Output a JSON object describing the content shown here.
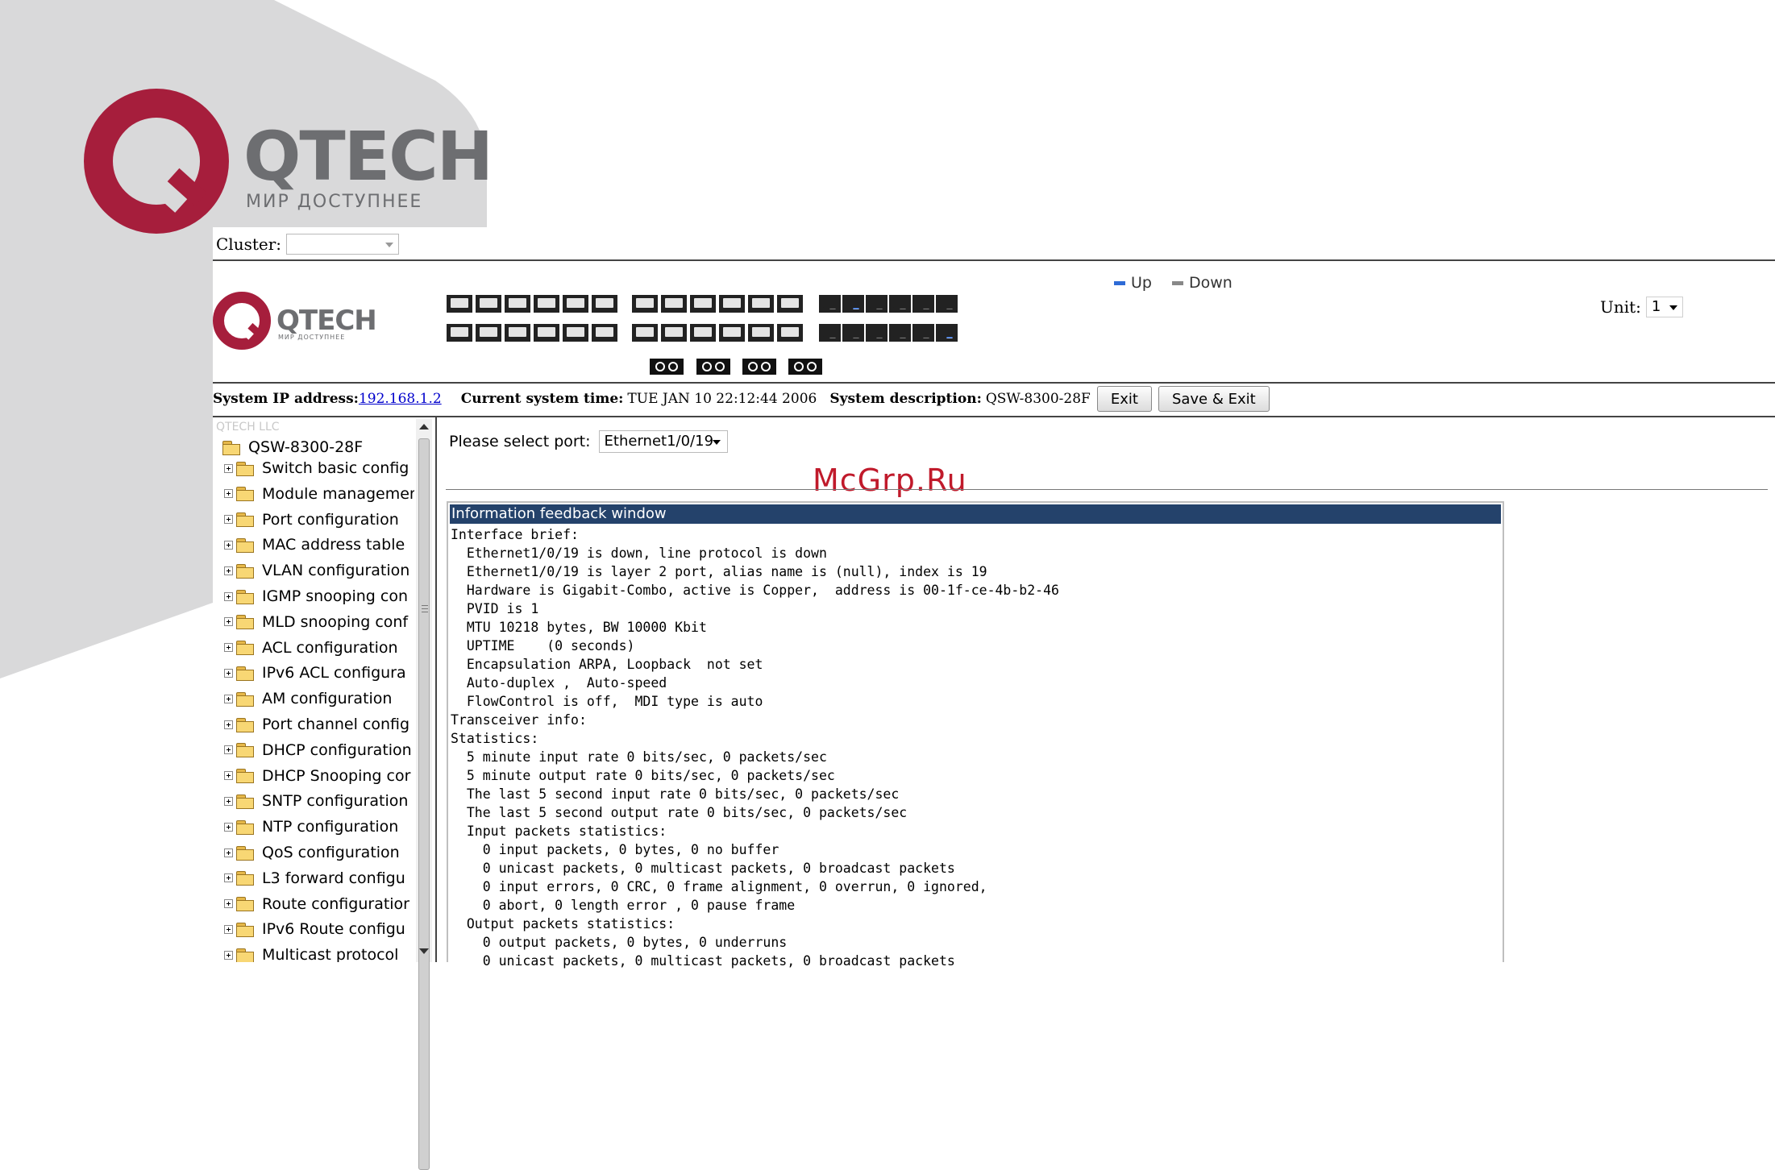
{
  "brand": {
    "name": "QTECH",
    "tagline": "МИР ДОСТУПНЕЕ",
    "colors": {
      "red": "#a61e3c",
      "gray": "#6d6e71",
      "shape": "#d9d9da"
    }
  },
  "cluster": {
    "label": "Cluster:",
    "value": ""
  },
  "panel": {
    "logo_name": "QTECH",
    "logo_tagline": "МИР ДОСТУПНЕЕ",
    "legend": {
      "up": "Up",
      "down": "Down",
      "up_color": "#2e6bd6",
      "down_color": "#888888"
    },
    "unit_label": "Unit:",
    "unit_value": "1",
    "rj45_up_ports": [
      2,
      12
    ]
  },
  "system_bar": {
    "ip_label": "System IP address:",
    "ip_value": "192.168.1.2",
    "time_label": "Current system time:",
    "time_value": "TUE JAN 10 22:12:44 2006",
    "desc_label": "System description:",
    "desc_value": "QSW-8300-28F",
    "exit_button": "Exit",
    "save_exit_button": "Save & Exit"
  },
  "sidebar": {
    "corp": "QTECH LLC",
    "root": "QSW-8300-28F",
    "items": [
      "Switch basic config",
      "Module managemen",
      "Port configuration",
      "MAC address table",
      "VLAN configuration",
      "IGMP snooping con",
      "MLD snooping conf",
      "ACL configuration",
      "IPv6 ACL configura",
      "AM configuration",
      "Port channel config",
      "DHCP configuration",
      "DHCP Snooping cor",
      "SNTP configuration",
      "NTP configuration",
      "QoS configuration",
      "L3 forward configu",
      "Route configuratior",
      "IPv6 Route configu",
      "Multicast protocol"
    ]
  },
  "main": {
    "select_label": "Please select port:",
    "selected_port": "Ethernet1/0/19",
    "watermark": "McGrp.Ru",
    "feedback_title": "Information feedback window",
    "feedback_lines": [
      "Interface brief:",
      "  Ethernet1/0/19 is down, line protocol is down",
      "  Ethernet1/0/19 is layer 2 port, alias name is (null), index is 19",
      "  Hardware is Gigabit-Combo, active is Copper,  address is 00-1f-ce-4b-b2-46",
      "  PVID is 1",
      "  MTU 10218 bytes, BW 10000 Kbit",
      "  UPTIME    (0 seconds)",
      "  Encapsulation ARPA, Loopback  not set",
      "  Auto-duplex ,  Auto-speed",
      "  FlowControl is off,  MDI type is auto",
      "Transceiver info:",
      "Statistics:",
      "  5 minute input rate 0 bits/sec, 0 packets/sec",
      "  5 minute output rate 0 bits/sec, 0 packets/sec",
      "  The last 5 second input rate 0 bits/sec, 0 packets/sec",
      "  The last 5 second output rate 0 bits/sec, 0 packets/sec",
      "  Input packets statistics:",
      "    0 input packets, 0 bytes, 0 no buffer",
      "    0 unicast packets, 0 multicast packets, 0 broadcast packets",
      "    0 input errors, 0 CRC, 0 frame alignment, 0 overrun, 0 ignored,",
      "    0 abort, 0 length error , 0 pause frame",
      "  Output packets statistics:",
      "    0 output packets, 0 bytes, 0 underruns",
      "    0 unicast packets, 0 multicast packets, 0 broadcast packets"
    ]
  }
}
